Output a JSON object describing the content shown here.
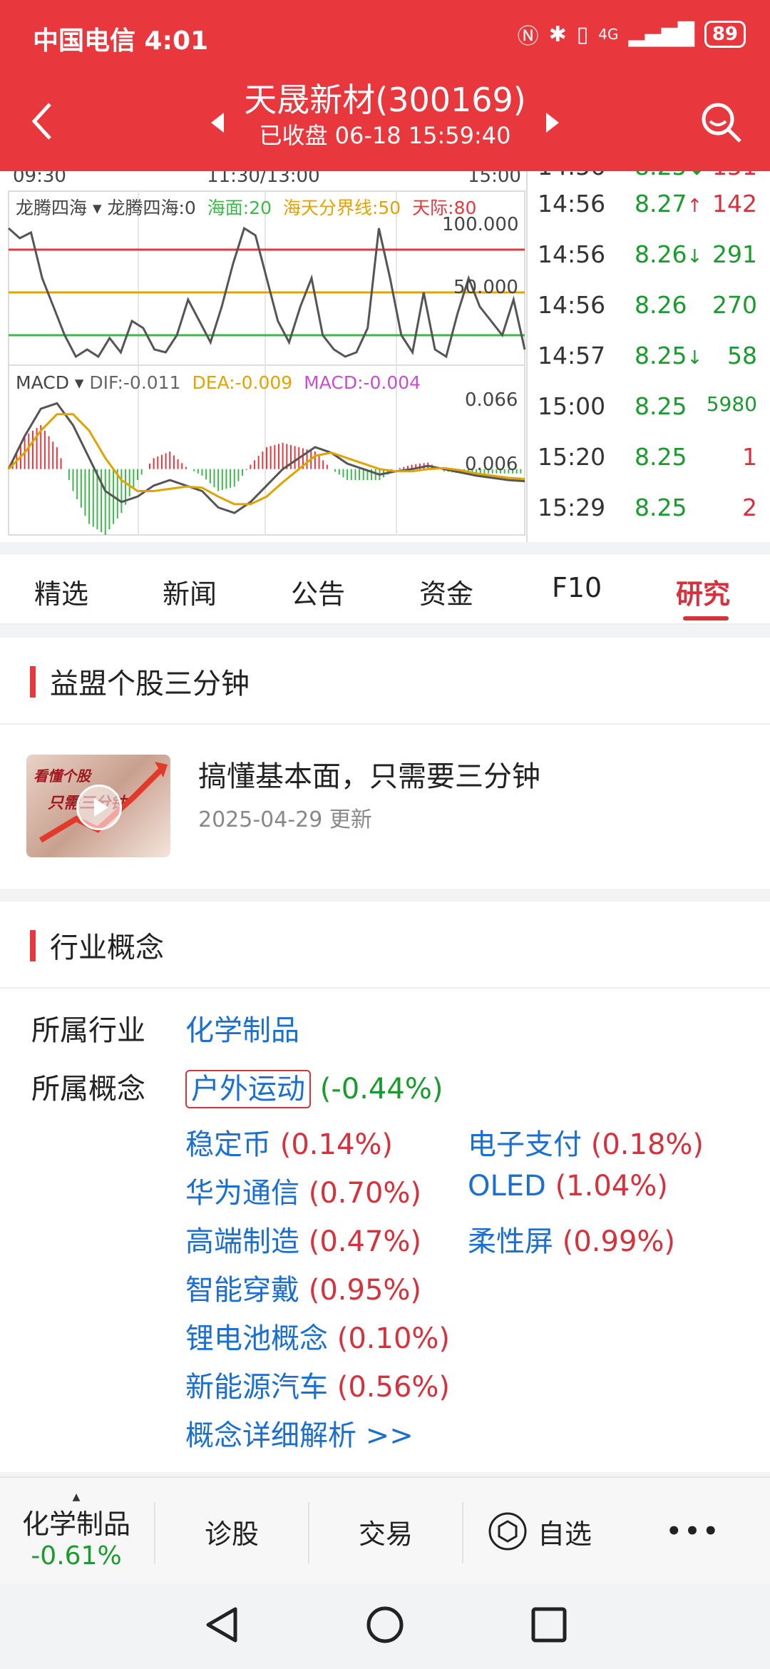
{
  "status_bar": {
    "carrier": "中国电信 4:01",
    "network": "4G",
    "battery": "89"
  },
  "header": {
    "title": "天晟新材(300169)",
    "subtitle": "已收盘  06-18 15:59:40"
  },
  "chart": {
    "top_time_labels": [
      "09:30",
      "11:30/13:00",
      "15:00"
    ],
    "indicator_legend": {
      "name": "龙腾四海",
      "items": [
        "龙腾四海:0",
        "海面:20",
        "海天分界线:50",
        "天际:80"
      ]
    },
    "indicator_axis": [
      "100.000",
      "50.000"
    ],
    "macd_legend": {
      "name": "MACD",
      "dif": "DIF:-0.011",
      "dea": "DEA:-0.009",
      "macd": "MACD:-0.004"
    },
    "macd_axis": [
      "0.066",
      "0.006"
    ],
    "colors": {
      "red_line": "#e8383d",
      "yellow_line": "#e0a400",
      "green_line": "#3cb94a",
      "gray_line": "#555555",
      "macd_pink": "#c54fd0"
    }
  },
  "chart_data": [
    {
      "type": "line",
      "title": "龙腾四海",
      "reference_lines": {
        "海面": 20,
        "海天分界线": 50,
        "天际": 80
      },
      "ylim": [
        0,
        100
      ],
      "series": [
        {
          "name": "龙腾四海",
          "values": [
            95,
            88,
            92,
            60,
            40,
            20,
            5,
            10,
            5,
            18,
            8,
            30,
            25,
            10,
            8,
            20,
            45,
            30,
            15,
            40,
            70,
            95,
            90,
            60,
            30,
            15,
            40,
            60,
            20,
            10,
            5,
            8,
            25,
            95,
            60,
            20,
            8,
            50,
            10,
            5,
            35,
            60,
            40,
            30,
            20,
            45,
            10
          ]
        }
      ]
    },
    {
      "type": "line",
      "title": "MACD",
      "ylim": [
        -0.06,
        0.07
      ],
      "series": [
        {
          "name": "DIF",
          "values": [
            0.0,
            0.03,
            0.055,
            0.06,
            0.04,
            0.01,
            -0.02,
            -0.03,
            -0.025,
            -0.015,
            -0.01,
            -0.015,
            -0.02,
            -0.035,
            -0.04,
            -0.03,
            -0.015,
            0.0,
            0.01,
            0.02,
            0.015,
            0.005,
            0.0,
            -0.005,
            -0.002,
            0.0,
            0.003,
            0.0,
            -0.003,
            -0.006,
            -0.008,
            -0.01,
            -0.011
          ]
        },
        {
          "name": "DEA",
          "values": [
            0.0,
            0.015,
            0.035,
            0.05,
            0.05,
            0.035,
            0.01,
            -0.01,
            -0.02,
            -0.02,
            -0.018,
            -0.016,
            -0.017,
            -0.025,
            -0.032,
            -0.032,
            -0.025,
            -0.012,
            0.0,
            0.012,
            0.015,
            0.01,
            0.005,
            0.0,
            -0.002,
            -0.002,
            0.0,
            0.001,
            -0.001,
            -0.004,
            -0.006,
            -0.008,
            -0.009
          ]
        }
      ]
    }
  ],
  "ticks": [
    {
      "time": "14:56",
      "price": "8.27",
      "dir": "↑",
      "volume": "142",
      "vol_color": "red"
    },
    {
      "time": "14:56",
      "price": "8.26",
      "dir": "↓",
      "volume": "291",
      "vol_color": "green"
    },
    {
      "time": "14:56",
      "price": "8.26",
      "dir": "",
      "volume": "270",
      "vol_color": "green"
    },
    {
      "time": "14:57",
      "price": "8.25",
      "dir": "↓",
      "volume": "58",
      "vol_color": "green"
    },
    {
      "time": "15:00",
      "price": "8.25",
      "dir": "",
      "volume": "5980",
      "vol_color": "green"
    },
    {
      "time": "15:20",
      "price": "8.25",
      "dir": "",
      "volume": "1",
      "vol_color": "red"
    },
    {
      "time": "15:29",
      "price": "8.25",
      "dir": "",
      "volume": "2",
      "vol_color": "red"
    }
  ],
  "tabs": [
    "精选",
    "新闻",
    "公告",
    "资金",
    "F10",
    "研究"
  ],
  "active_tab": "研究",
  "section1": {
    "title": "益盟个股三分钟",
    "video_title": "搞懂基本面，只需要三分钟",
    "video_date": "2025-04-29 更新",
    "thumb_text1": "看懂个股",
    "thumb_text2": "只需三分钟"
  },
  "section2": {
    "title": "行业概念",
    "industry_label": "所属行业",
    "industry": "化学制品",
    "concept_label": "所属概念",
    "concepts": [
      {
        "name": "户外运动",
        "change": "(-0.44%)"
      },
      {
        "name": "稳定币",
        "change": "(0.14%)"
      },
      {
        "name": "电子支付",
        "change": "(0.18%)"
      },
      {
        "name": "华为通信",
        "change": "(0.70%)"
      },
      {
        "name": "OLED",
        "change": "(1.04%)"
      },
      {
        "name": "高端制造",
        "change": "(0.47%)"
      },
      {
        "name": "柔性屏",
        "change": "(0.99%)"
      },
      {
        "name": "智能穿戴",
        "change": "(0.95%)"
      },
      {
        "name": "锂电池概念",
        "change": "(0.10%)"
      },
      {
        "name": "新能源汽车",
        "change": "(0.56%)"
      }
    ],
    "detail_link": "概念详细解析 >>"
  },
  "bottom_bar": {
    "sector_name": "化学制品",
    "sector_change": "-0.61%",
    "diagnose": "诊股",
    "trade": "交易",
    "watchlist": "自选",
    "more": "•••"
  }
}
